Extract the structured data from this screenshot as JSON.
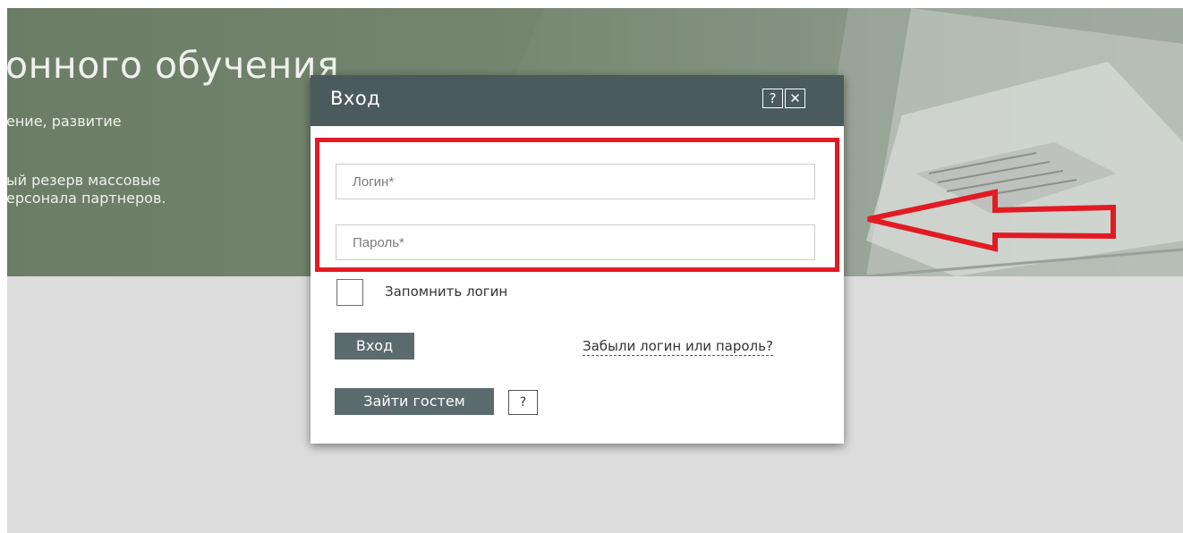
{
  "hero": {
    "title": "онного обучения",
    "subtitle": "ение, развитие",
    "description": [
      "ый резерв массовые",
      "ерсонала партнеров."
    ]
  },
  "modal": {
    "title": "Вход",
    "help_icon": "?",
    "close_icon": "✕",
    "login_placeholder": "Логин*",
    "password_placeholder": "Пароль*",
    "remember_label": "Запомнить логин",
    "login_button": "Вход",
    "forgot_link": "Забыли логин или пароль?",
    "guest_button": "Зайти гостем",
    "guest_help": "?"
  },
  "colors": {
    "accent": "#4b5a5c",
    "highlight": "#e21b23",
    "button": "#5b6a6c"
  }
}
